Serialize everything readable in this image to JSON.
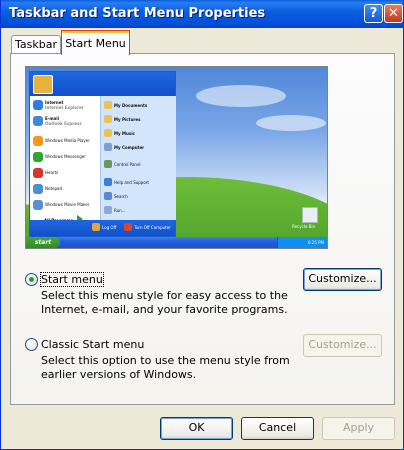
{
  "window": {
    "title": "Taskbar and Start Menu Properties",
    "help_symbol": "?",
    "close_symbol": "✕"
  },
  "tabs": [
    {
      "label": "Taskbar",
      "selected": false
    },
    {
      "label": "Start Menu",
      "selected": true
    }
  ],
  "preview": {
    "start_menu_left": [
      {
        "label": "Internet",
        "sub": "Internet Explorer",
        "color": "#2f7be8"
      },
      {
        "label": "E-mail",
        "sub": "Outlook Express",
        "color": "#3c8ad8"
      },
      {
        "label": "Windows Media Player",
        "color": "#f39a1c"
      },
      {
        "label": "Windows Messenger",
        "color": "#2fa62f"
      },
      {
        "label": "Hearts",
        "color": "#d9332b"
      },
      {
        "label": "Notepad",
        "color": "#4a90d0"
      },
      {
        "label": "Windows Movie Maker",
        "color": "#5b8fd6"
      }
    ],
    "all_programs": "All Programs",
    "start_menu_right": [
      {
        "label": "My Documents",
        "color": "#e8c35a"
      },
      {
        "label": "My Pictures",
        "color": "#e8c35a"
      },
      {
        "label": "My Music",
        "color": "#e8c35a"
      },
      {
        "label": "My Computer",
        "color": "#7aa0d6"
      },
      {
        "label": "Control Panel",
        "color": "#6a9a5b"
      },
      {
        "label": "Help and Support",
        "color": "#3f7fd1"
      },
      {
        "label": "Search",
        "color": "#5a8ad6"
      },
      {
        "label": "Run...",
        "color": "#8aa8d8"
      }
    ],
    "log_off": "Log Off",
    "turn_off": "Turn Off Computer",
    "recycle_bin": "Recycle Bin",
    "start_button": "start",
    "clock": "6:25 PM"
  },
  "options": {
    "start_menu": {
      "label": "Start menu",
      "selected": true,
      "description": "Select this menu style for easy access to the Internet, e-mail, and your favorite programs."
    },
    "classic": {
      "label": "Classic Start menu",
      "selected": false,
      "description": "Select this option to use the menu style from earlier versions of Windows."
    }
  },
  "buttons": {
    "customize_start": "Customize...",
    "customize_classic": "Customize...",
    "ok": "OK",
    "cancel": "Cancel",
    "apply": "Apply"
  }
}
